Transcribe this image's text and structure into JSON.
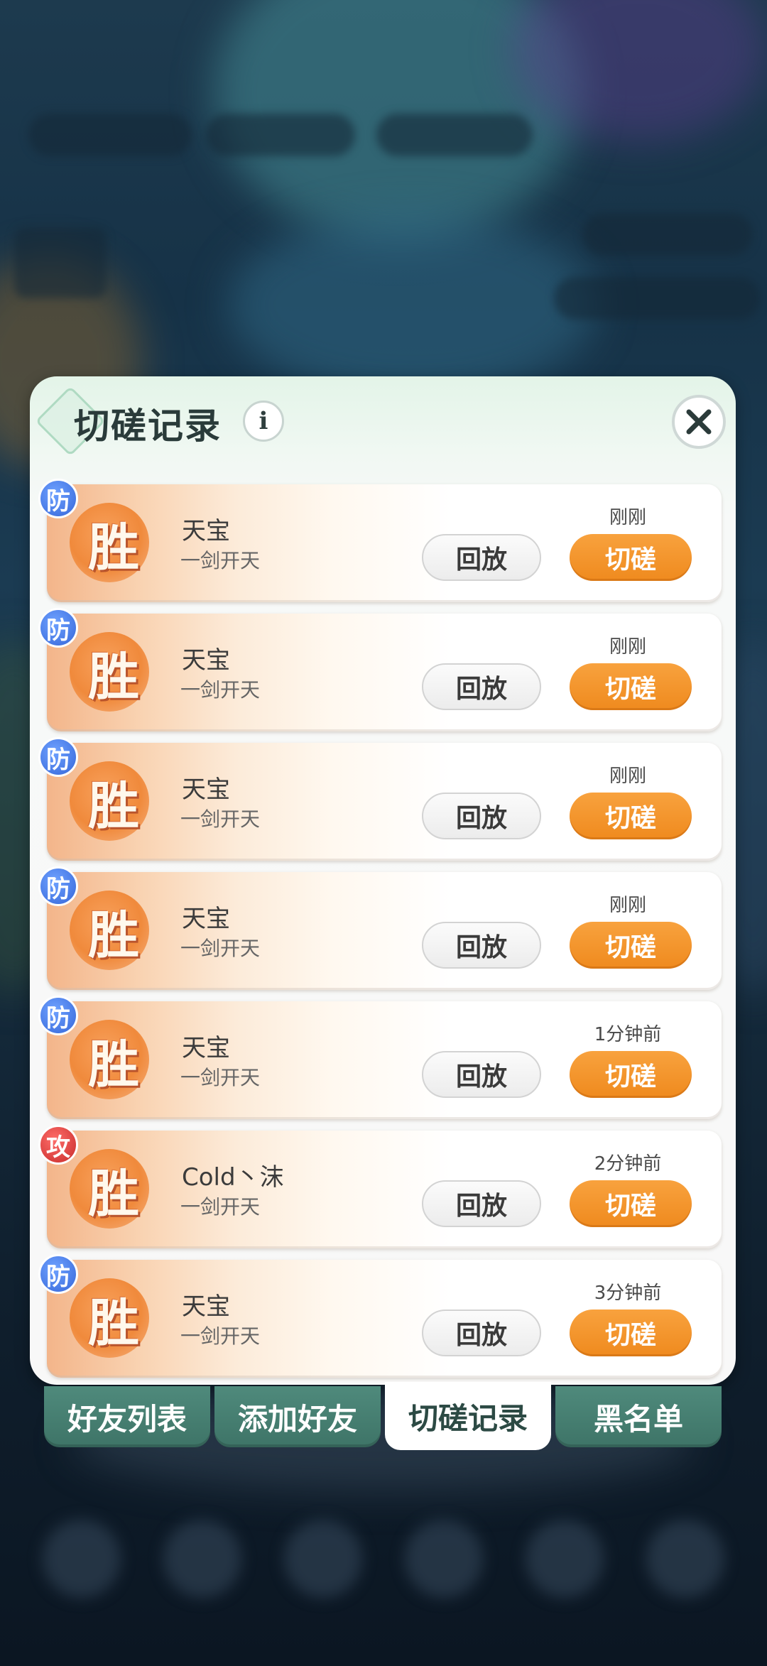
{
  "panel": {
    "title": "切磋记录",
    "info_glyph": "i"
  },
  "records": [
    {
      "role": "防",
      "role_type": "defense",
      "result": "胜",
      "name": "天宝",
      "sub": "一剑开天",
      "time": "刚刚",
      "replay_label": "回放",
      "spar_label": "切磋"
    },
    {
      "role": "防",
      "role_type": "defense",
      "result": "胜",
      "name": "天宝",
      "sub": "一剑开天",
      "time": "刚刚",
      "replay_label": "回放",
      "spar_label": "切磋"
    },
    {
      "role": "防",
      "role_type": "defense",
      "result": "胜",
      "name": "天宝",
      "sub": "一剑开天",
      "time": "刚刚",
      "replay_label": "回放",
      "spar_label": "切磋"
    },
    {
      "role": "防",
      "role_type": "defense",
      "result": "胜",
      "name": "天宝",
      "sub": "一剑开天",
      "time": "刚刚",
      "replay_label": "回放",
      "spar_label": "切磋"
    },
    {
      "role": "防",
      "role_type": "defense",
      "result": "胜",
      "name": "天宝",
      "sub": "一剑开天",
      "time": "1分钟前",
      "replay_label": "回放",
      "spar_label": "切磋"
    },
    {
      "role": "攻",
      "role_type": "attack",
      "result": "胜",
      "name": "Cold丶沫",
      "sub": "一剑开天",
      "time": "2分钟前",
      "replay_label": "回放",
      "spar_label": "切磋"
    },
    {
      "role": "防",
      "role_type": "defense",
      "result": "胜",
      "name": "天宝",
      "sub": "一剑开天",
      "time": "3分钟前",
      "replay_label": "回放",
      "spar_label": "切磋"
    }
  ],
  "tabs": [
    {
      "label": "好友列表",
      "active": false
    },
    {
      "label": "添加好友",
      "active": false
    },
    {
      "label": "切磋记录",
      "active": true
    },
    {
      "label": "黑名单",
      "active": false
    }
  ],
  "colors": {
    "spar_button": "#ef8a1e",
    "defense_badge": "#3566d9",
    "attack_badge": "#c72a2a",
    "tab_inactive": "#4f8a7c"
  },
  "icons": {
    "close": "close-icon",
    "info": "info-icon",
    "title_ornament": "diamond-ornament-icon"
  }
}
